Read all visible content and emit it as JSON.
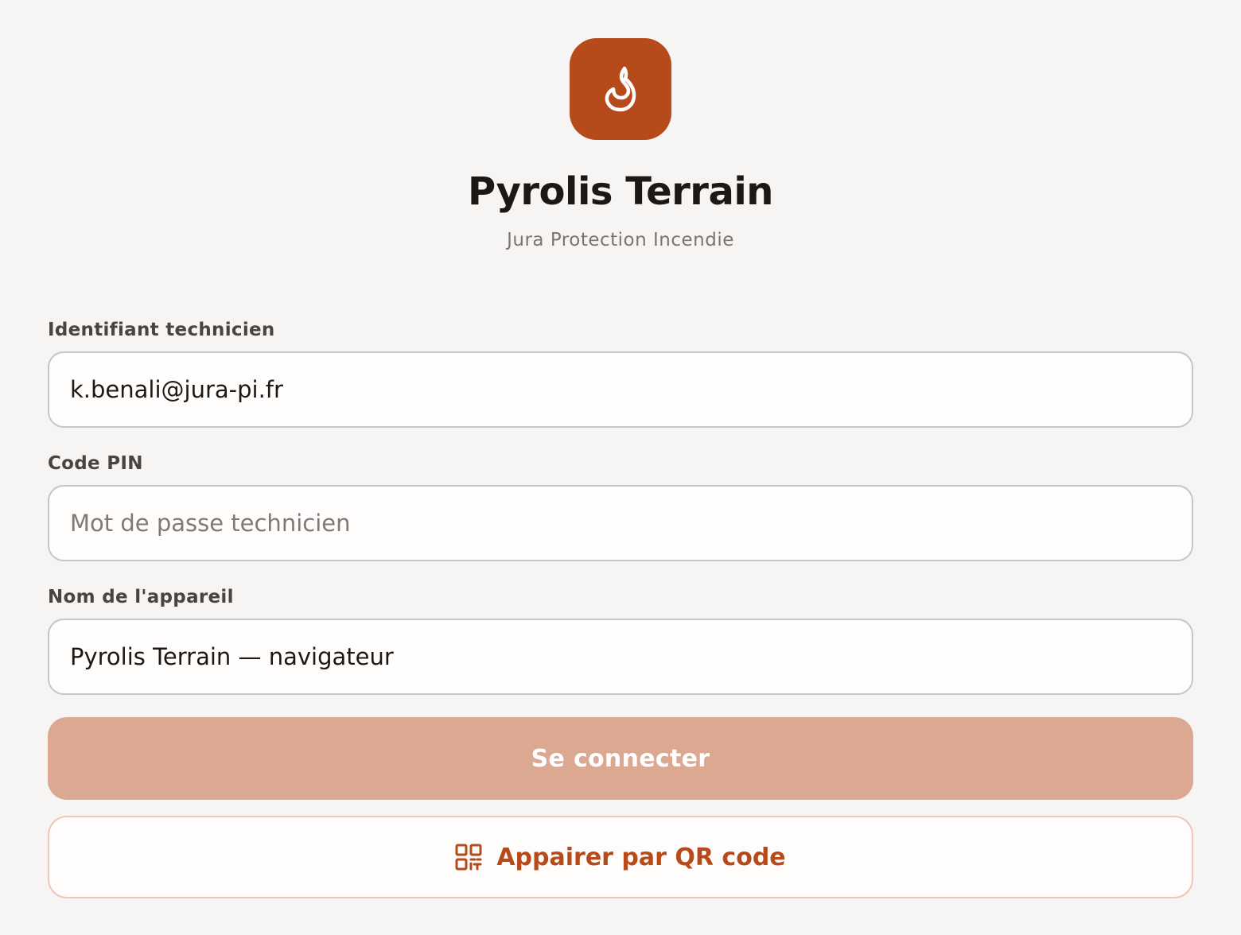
{
  "app": {
    "title": "Pyrolis Terrain",
    "subtitle": "Jura Protection Incendie",
    "logo_icon": "flame-icon",
    "accent_color": "#b74a1a"
  },
  "form": {
    "identifier": {
      "label": "Identifiant technicien",
      "value": "k.benali@jura-pi.fr"
    },
    "pin": {
      "label": "Code PIN",
      "value": "",
      "placeholder": "Mot de passe technicien"
    },
    "device": {
      "label": "Nom de l'appareil",
      "value": "Pyrolis Terrain — navigateur"
    }
  },
  "actions": {
    "login_label": "Se connecter",
    "login_color": "#dba992",
    "qr_label": "Appairer par QR code",
    "qr_icon": "qr-code-icon"
  }
}
